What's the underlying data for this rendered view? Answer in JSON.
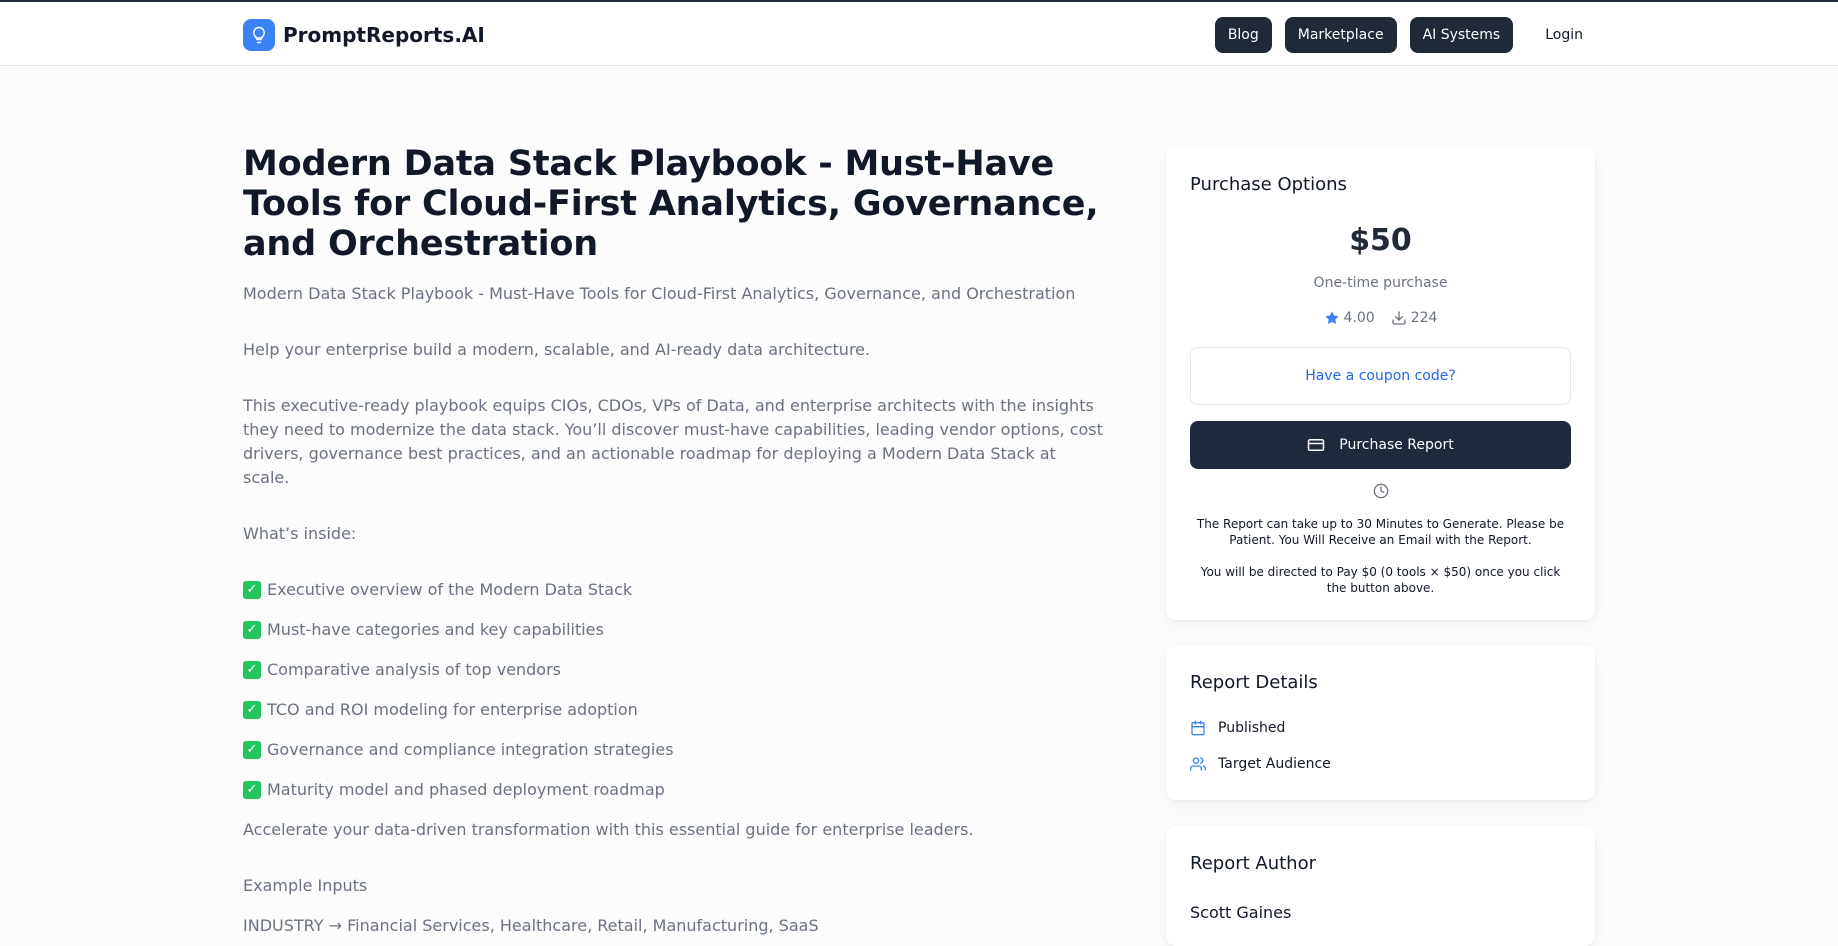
{
  "header": {
    "brand": "PromptReports.AI",
    "nav": {
      "blog": "Blog",
      "marketplace": "Marketplace",
      "ai_systems": "AI Systems",
      "login": "Login"
    }
  },
  "main": {
    "title": "Modern Data Stack Playbook - Must-Have Tools for Cloud-First Analytics, Governance, and Orchestration",
    "subtitle": "Modern Data Stack Playbook - Must-Have Tools for Cloud-First Analytics, Governance, and Orchestration",
    "intro": "Help your enterprise build a modern, scalable, and AI-ready data architecture.",
    "description": "This executive-ready playbook equips CIOs, CDOs, VPs of Data, and enterprise architects with the insights they need to modernize the data stack. You’ll discover must-have capabilities, leading vendor options, cost drivers, governance best practices, and an actionable roadmap for deploying a Modern Data Stack at scale.",
    "whats_inside": "What’s inside:",
    "items": [
      "Executive overview of the Modern Data Stack",
      "Must-have categories and key capabilities",
      "Comparative analysis of top vendors",
      "TCO and ROI modeling for enterprise adoption",
      "Governance and compliance integration strategies",
      "Maturity model and phased deployment roadmap"
    ],
    "closing": "Accelerate your data-driven transformation with this essential guide for enterprise leaders.",
    "example_inputs_title": "Example Inputs",
    "example_input_1": "INDUSTRY → Financial Services, Healthcare, Retail, Manufacturing, SaaS"
  },
  "purchase": {
    "title": "Purchase Options",
    "price": "$50",
    "price_note": "One-time purchase",
    "rating": "4.00",
    "downloads": "224",
    "coupon": "Have a coupon code?",
    "button": "Purchase Report",
    "wait_note": "The Report can take up to 30 Minutes to Generate. Please be Patient. You Will Receive an Email with the Report.",
    "pay_note": "You will be directed to Pay $0 (0 tools × $50) once you click the button above."
  },
  "details": {
    "title": "Report Details",
    "published": "Published",
    "audience": "Target Audience"
  },
  "author": {
    "title": "Report Author",
    "name": "Scott Gaines"
  },
  "colors": {
    "accent": "#3b82f6",
    "button_dark": "#1e293b",
    "link": "#2563eb",
    "check": "#22c55e"
  },
  "icons": [
    "lightbulb-icon",
    "star-icon",
    "download-icon",
    "card-icon",
    "clock-icon",
    "calendar-icon",
    "users-icon",
    "check-icon"
  ]
}
